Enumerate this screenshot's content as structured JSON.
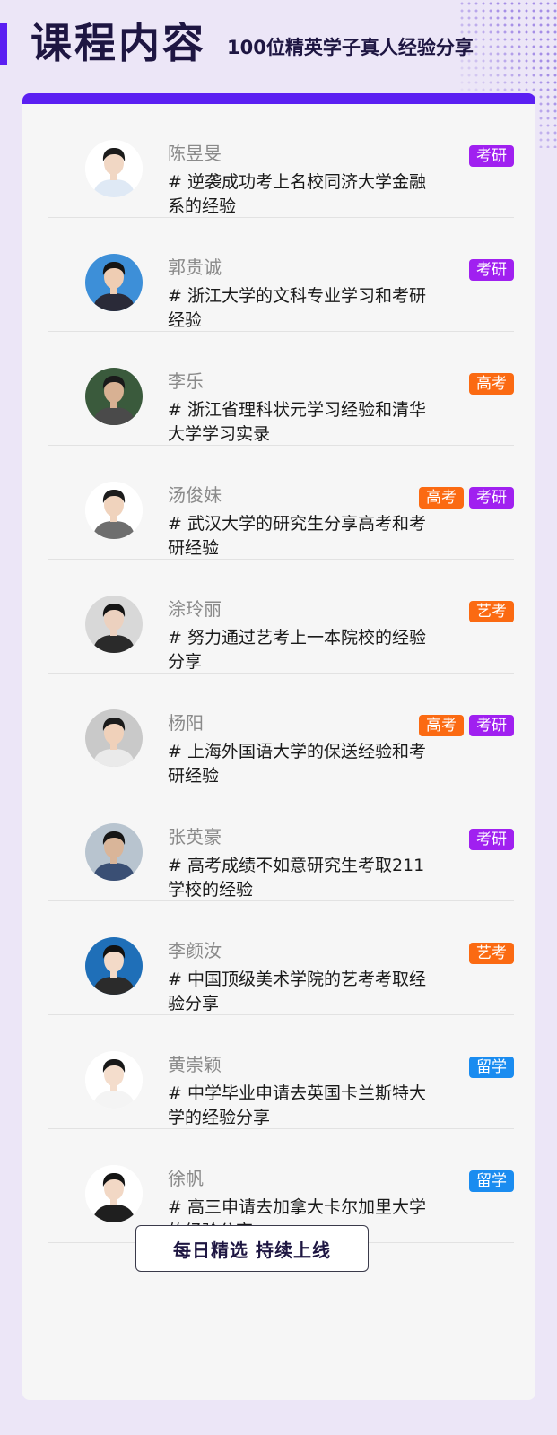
{
  "header": {
    "title": "课程内容",
    "subtitle": "100位精英学子真人经验分享"
  },
  "colors": {
    "accent": "#5b1ff2",
    "tag_kaoyan": "#a020f0",
    "tag_gaokao": "#fb6a12",
    "tag_yikao": "#fb6a12",
    "tag_liuxue": "#1a8cf0"
  },
  "students": [
    {
      "name": "陈昱旻",
      "desc": "# 逆袭成功考上名校同济大学金融系的经验",
      "tags": [
        {
          "label": "考研",
          "kind": "kaoyan"
        }
      ],
      "avatar": {
        "skin": "#f1d7c4",
        "hair": "#1b1b1b",
        "shirt": "#dfe9f5",
        "bg": "#ffffff"
      }
    },
    {
      "name": "郭贵诚",
      "desc": "# 浙江大学的文科专业学习和考研经验",
      "tags": [
        {
          "label": "考研",
          "kind": "kaoyan"
        }
      ],
      "avatar": {
        "skin": "#efcdb3",
        "hair": "#151515",
        "shirt": "#2a2a38",
        "bg": "#3d8fd8"
      }
    },
    {
      "name": "李乐",
      "desc": "# 浙江省理科状元学习经验和清华大学学习实录",
      "tags": [
        {
          "label": "高考",
          "kind": "gaokao"
        }
      ],
      "avatar": {
        "skin": "#d8b193",
        "hair": "#1a1a1a",
        "shirt": "#4a4a4a",
        "bg": "#3a5a3c"
      }
    },
    {
      "name": "汤俊妹",
      "desc": "# 武汉大学的研究生分享高考和考研经验",
      "tags": [
        {
          "label": "高考",
          "kind": "gaokao"
        },
        {
          "label": "考研",
          "kind": "kaoyan"
        }
      ],
      "avatar": {
        "skin": "#f0d3bd",
        "hair": "#1c1c1c",
        "shirt": "#6e6e6e",
        "bg": "#ffffff"
      }
    },
    {
      "name": "涂玲丽",
      "desc": "# 努力通过艺考上一本院校的经验分享",
      "tags": [
        {
          "label": "艺考",
          "kind": "yikao"
        }
      ],
      "avatar": {
        "skin": "#ecd1bf",
        "hair": "#141414",
        "shirt": "#2a2a2a",
        "bg": "#d8d8d8"
      }
    },
    {
      "name": "杨阳",
      "desc": "# 上海外国语大学的保送经验和考研经验",
      "tags": [
        {
          "label": "高考",
          "kind": "gaokao"
        },
        {
          "label": "考研",
          "kind": "kaoyan"
        }
      ],
      "avatar": {
        "skin": "#f0d1ba",
        "hair": "#1b1b1b",
        "shirt": "#eaeaea",
        "bg": "#c9c9c9"
      }
    },
    {
      "name": "张英豪",
      "desc": "# 高考成绩不如意研究生考取211学校的经验",
      "tags": [
        {
          "label": "考研",
          "kind": "kaoyan"
        }
      ],
      "avatar": {
        "skin": "#d9b599",
        "hair": "#161616",
        "shirt": "#3a4f74",
        "bg": "#b8c4cf"
      }
    },
    {
      "name": "李颜汝",
      "desc": "# 中国顶级美术学院的艺考考取经验分享",
      "tags": [
        {
          "label": "艺考",
          "kind": "yikao"
        }
      ],
      "avatar": {
        "skin": "#f3dac8",
        "hair": "#121212",
        "shirt": "#2b2b2b",
        "bg": "#1f6fb8"
      }
    },
    {
      "name": "黄崇颖",
      "desc": "# 中学毕业申请去英国卡兰斯特大学的经验分享",
      "tags": [
        {
          "label": "留学",
          "kind": "liuxue"
        }
      ],
      "avatar": {
        "skin": "#f4ddcc",
        "hair": "#181818",
        "shirt": "#f4f4f4",
        "bg": "#ffffff"
      }
    },
    {
      "name": "徐帆",
      "desc": "# 高三申请去加拿大卡尔加里大学的经验分享",
      "tags": [
        {
          "label": "留学",
          "kind": "liuxue"
        }
      ],
      "avatar": {
        "skin": "#f2d8c5",
        "hair": "#141414",
        "shirt": "#1f1f1f",
        "bg": "#ffffff"
      }
    }
  ],
  "cta": {
    "label": "每日精选 持续上线"
  }
}
